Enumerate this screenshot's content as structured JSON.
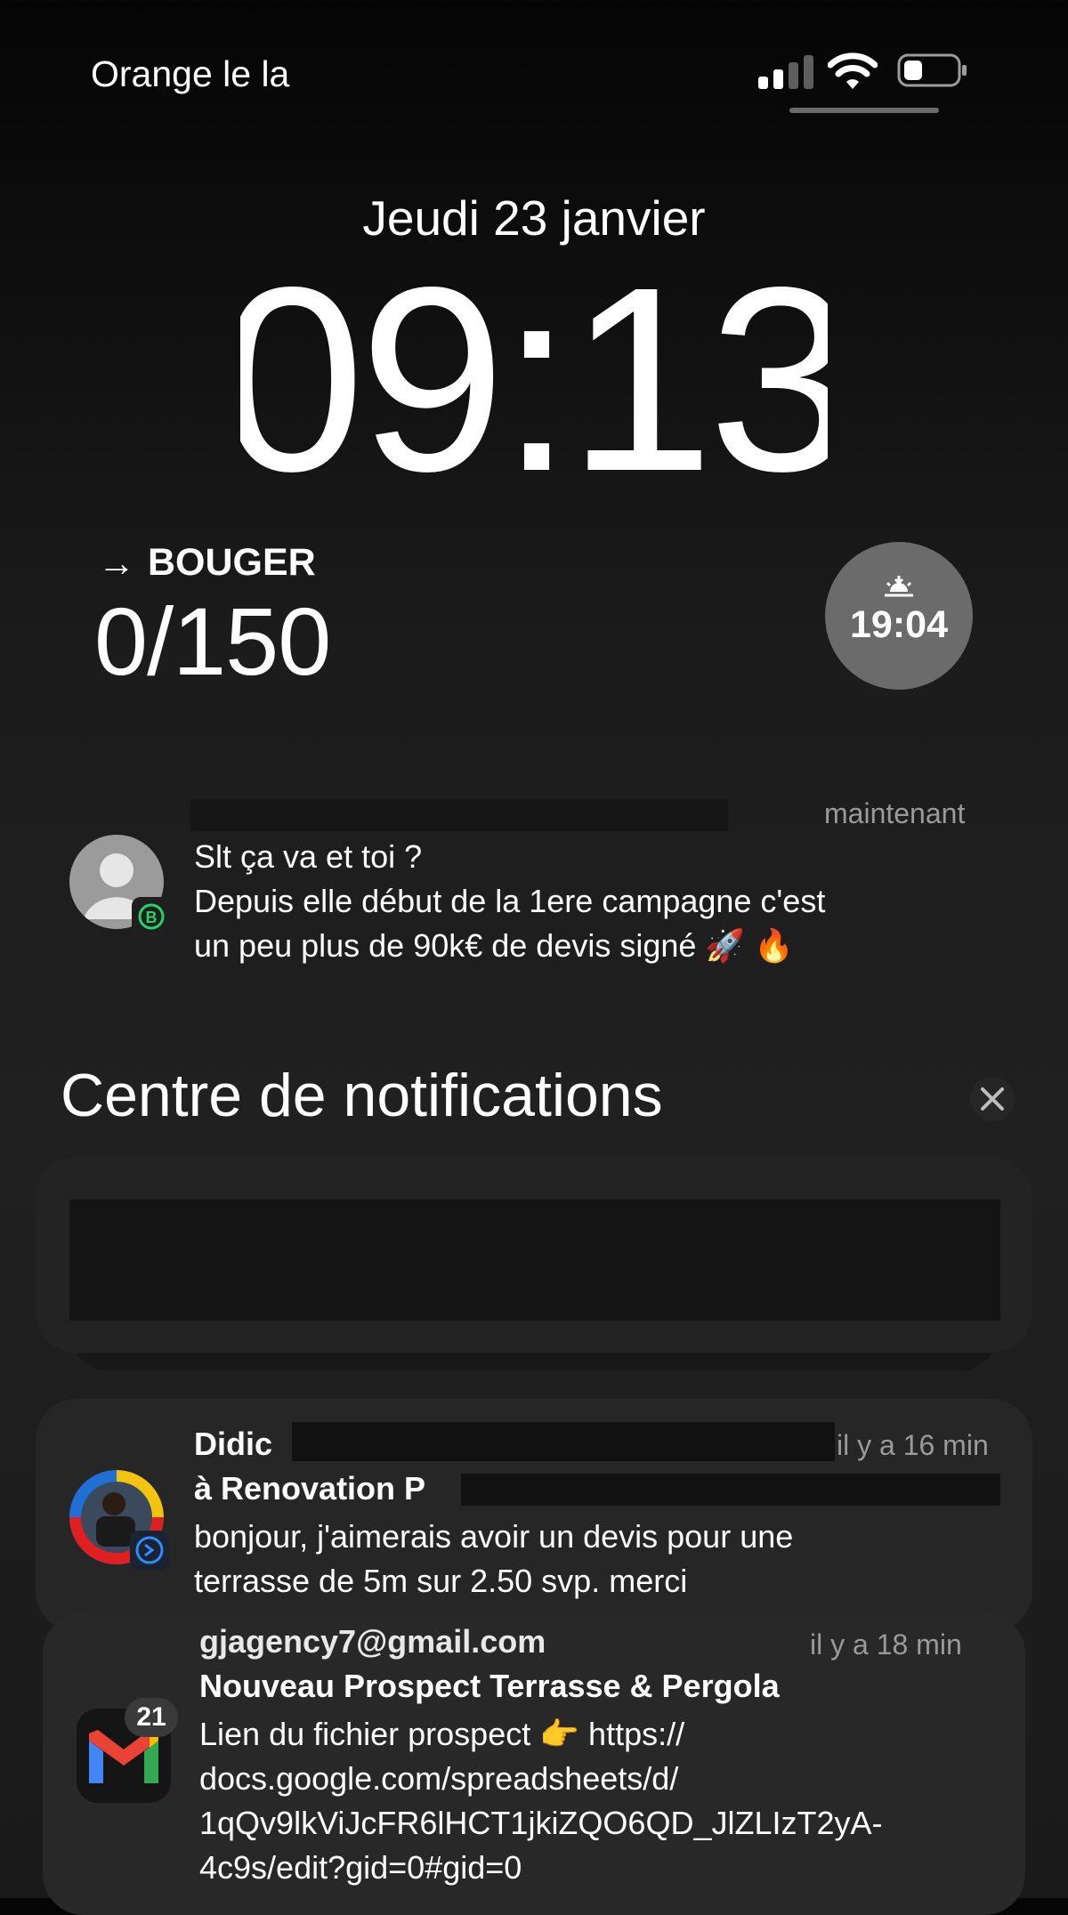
{
  "status_bar": {
    "carrier": "Orange le la",
    "signal_bars": 2,
    "battery_level": 0.3
  },
  "lock_screen": {
    "date": "Jeudi 23 janvier",
    "time": "09:13",
    "widget": {
      "arrow": "→",
      "label": "BOUGER",
      "value": "0/150"
    },
    "sunset": {
      "icon": "sunset-icon",
      "time": "19:04"
    }
  },
  "top_notification": {
    "app_icon": "whatsapp-business-icon",
    "time": "maintenant",
    "lines": [
      "Slt ça va et toi ?",
      "Depuis elle début de la 1ere campagne c'est",
      "un peu plus de 90k€ de devis signé 🚀 🔥"
    ]
  },
  "notification_center": {
    "title": "Centre de notifications",
    "close_icon": "close-icon"
  },
  "notifications": [
    {
      "app_icon": "messenger-icon",
      "sender": "Didic",
      "time": "il y a 16 min",
      "recipient": "à Renovation P",
      "lines": [
        "bonjour, j'aimerais avoir un devis pour une",
        "terrasse de 5m  sur 2.50 svp. merci"
      ]
    },
    {
      "app_icon": "gmail-icon",
      "badge": "21",
      "sender": "gjagency7@gmail.com",
      "time": "il y a 18 min",
      "subject": "Nouveau Prospect Terrasse & Pergola",
      "lines": [
        "Lien du fichier prospect 👉 https://",
        "docs.google.com/spreadsheets/d/",
        "1qQv9lkViJcFR6lHCT1jkiZQO6QD_JlZLIzT2yA-",
        "4c9s/edit?gid=0#gid=0"
      ]
    }
  ]
}
